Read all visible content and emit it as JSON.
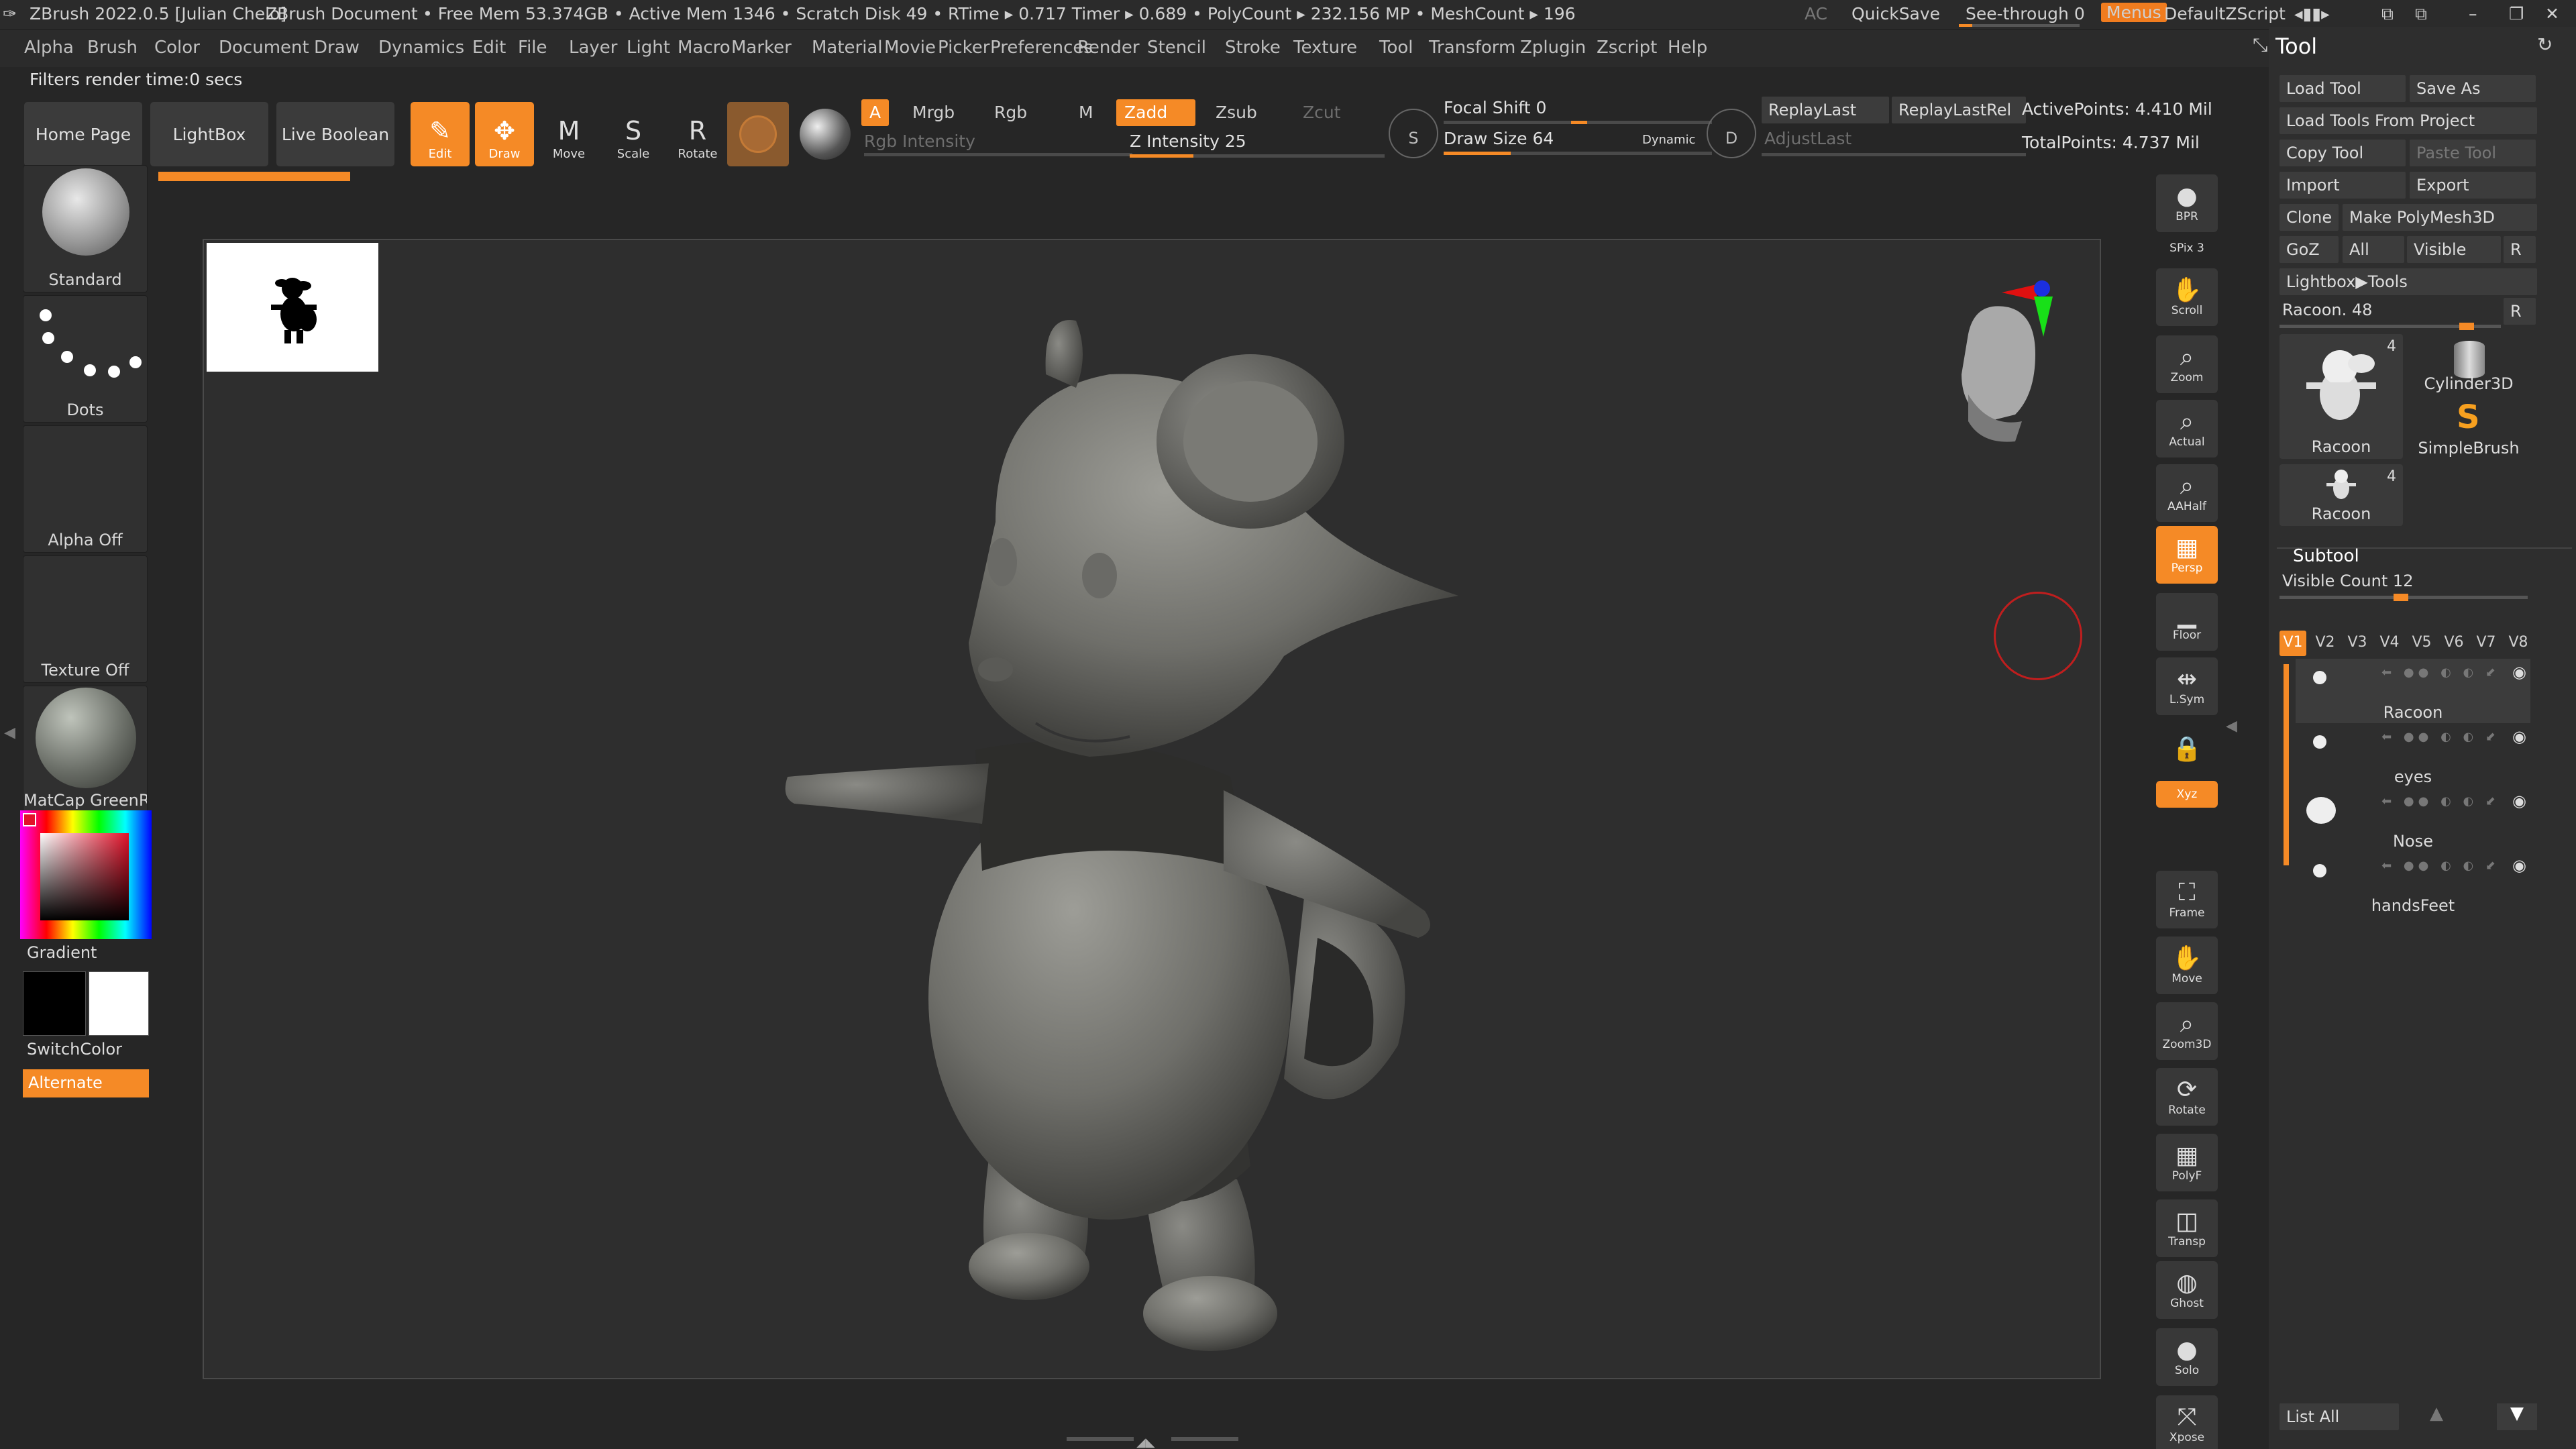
{
  "titlebar": {
    "app": "ZBrush 2022.0.5 [Julian Chelo]",
    "document": "ZBrush Document",
    "stats": "• Free Mem 53.374GB • Active Mem 1346 • Scratch Disk 49 •  RTime ▸ 0.717 Timer ▸ 0.689 • PolyCount ▸ 232.156 MP  • MeshCount ▸ 196",
    "ac": "AC",
    "quicksave": "QuickSave",
    "seethrough": "See-through  0",
    "menus": "Menus",
    "script": "DefaultZScript"
  },
  "menubar": [
    "Alpha",
    "Brush",
    "Color",
    "Document",
    "Draw",
    "Dynamics",
    "Edit",
    "File",
    "Layer",
    "Light",
    "Macro",
    "Marker",
    "Material",
    "Movie",
    "Picker",
    "Preferences",
    "Render",
    "Stencil",
    "Stroke",
    "Texture",
    "Tool",
    "Transform",
    "Zplugin",
    "Zscript",
    "Help"
  ],
  "status": "Filters render time:0 secs",
  "shelf": {
    "home": "Home Page",
    "lightbox": "LightBox",
    "live_boolean": "Live Boolean",
    "tools": [
      {
        "label": "Edit",
        "icon": "✎",
        "active": true
      },
      {
        "label": "Draw",
        "icon": "✥",
        "active": true
      },
      {
        "label": "Move",
        "icon": "M",
        "active": false
      },
      {
        "label": "Scale",
        "icon": "S",
        "active": false
      },
      {
        "label": "Rotate",
        "icon": "R",
        "active": false
      }
    ],
    "a": "A",
    "mrgb": "Mrgb",
    "rgb": "Rgb",
    "m": "M",
    "zadd": "Zadd",
    "zsub": "Zsub",
    "zcut": "Zcut",
    "rgb_intensity": "Rgb Intensity",
    "z_intensity": "Z Intensity 25",
    "focal_shift": "Focal Shift 0",
    "draw_size": "Draw Size 64",
    "dynamic": "Dynamic",
    "replay_last": "ReplayLast",
    "replay_last_rel": "ReplayLastRel",
    "adjust_last": "AdjustLast",
    "active_points": "ActivePoints: 4.410 Mil",
    "total_points": "TotalPoints: 4.737 Mil",
    "z_intensity_value": 0.25,
    "focal_shift_value": 0.5,
    "draw_size_value": 0.25
  },
  "left": {
    "brush": "Standard",
    "stroke": "Dots",
    "alpha": "Alpha Off",
    "texture": "Texture Off",
    "material": "MatCap GreenRo",
    "gradient": "Gradient",
    "switchcolor": "SwitchColor",
    "alternate": "Alternate"
  },
  "right_icons": [
    {
      "label": "BPR",
      "icon": "●",
      "active": false
    },
    {
      "label": "SPix 3",
      "icon": "",
      "active": false
    },
    {
      "label": "Scroll",
      "icon": "✋",
      "active": false
    },
    {
      "label": "Zoom",
      "icon": "⌕",
      "active": false
    },
    {
      "label": "Actual",
      "icon": "⌕",
      "active": false
    },
    {
      "label": "AAHalf",
      "icon": "⌕",
      "active": false
    },
    {
      "label": "Persp",
      "icon": "▦",
      "active": true
    },
    {
      "label": "Floor",
      "icon": "▁",
      "active": false
    },
    {
      "label": "L.Sym",
      "icon": "⇹",
      "active": false
    },
    {
      "label": "",
      "icon": "🔒",
      "active": false
    },
    {
      "label": "Xyz",
      "icon": "",
      "active": true
    },
    {
      "label": "Frame",
      "icon": "⛶",
      "active": false
    },
    {
      "label": "Move",
      "icon": "✋",
      "active": false
    },
    {
      "label": "Zoom3D",
      "icon": "⌕",
      "active": false
    },
    {
      "label": "Rotate",
      "icon": "⟳",
      "active": false
    },
    {
      "label": "PolyF",
      "icon": "▦",
      "active": false
    },
    {
      "label": "Transp",
      "icon": "◫",
      "active": false
    },
    {
      "label": "Ghost",
      "icon": "◍",
      "active": false
    },
    {
      "label": "Solo",
      "icon": "●",
      "active": false
    },
    {
      "label": "Xpose",
      "icon": "⤧",
      "active": false
    }
  ],
  "toolpanel": {
    "title": "Tool",
    "load_tool": "Load Tool",
    "save_as": "Save As",
    "load_from_project": "Load Tools From Project",
    "copy_tool": "Copy Tool",
    "paste_tool": "Paste Tool",
    "import": "Import",
    "export": "Export",
    "clone": "Clone",
    "make_polymesh": "Make PolyMesh3D",
    "goz": "GoZ",
    "all": "All",
    "visible": "Visible",
    "r": "R",
    "lightbox_tools": "Lightbox▶Tools",
    "current_tool": "Racoon. 48",
    "thumbs": [
      {
        "name": "Racoon",
        "count": "4"
      },
      {
        "name": "Cylinder3D",
        "count": ""
      },
      {
        "name": "SimpleBrush",
        "count": ""
      },
      {
        "name": "Racoon",
        "count": "4"
      }
    ],
    "subtool": "Subtool",
    "visible_count": "Visible Count 12",
    "versions": [
      "V1",
      "V2",
      "V3",
      "V4",
      "V5",
      "V6",
      "V7",
      "V8"
    ],
    "subtools": [
      "Racoon",
      "eyes",
      "Nose",
      "handsFeet"
    ],
    "list_all": "List All"
  },
  "colors": {
    "accent": "#f58a26",
    "background": "#262626",
    "panel": "#2e2e2e"
  }
}
